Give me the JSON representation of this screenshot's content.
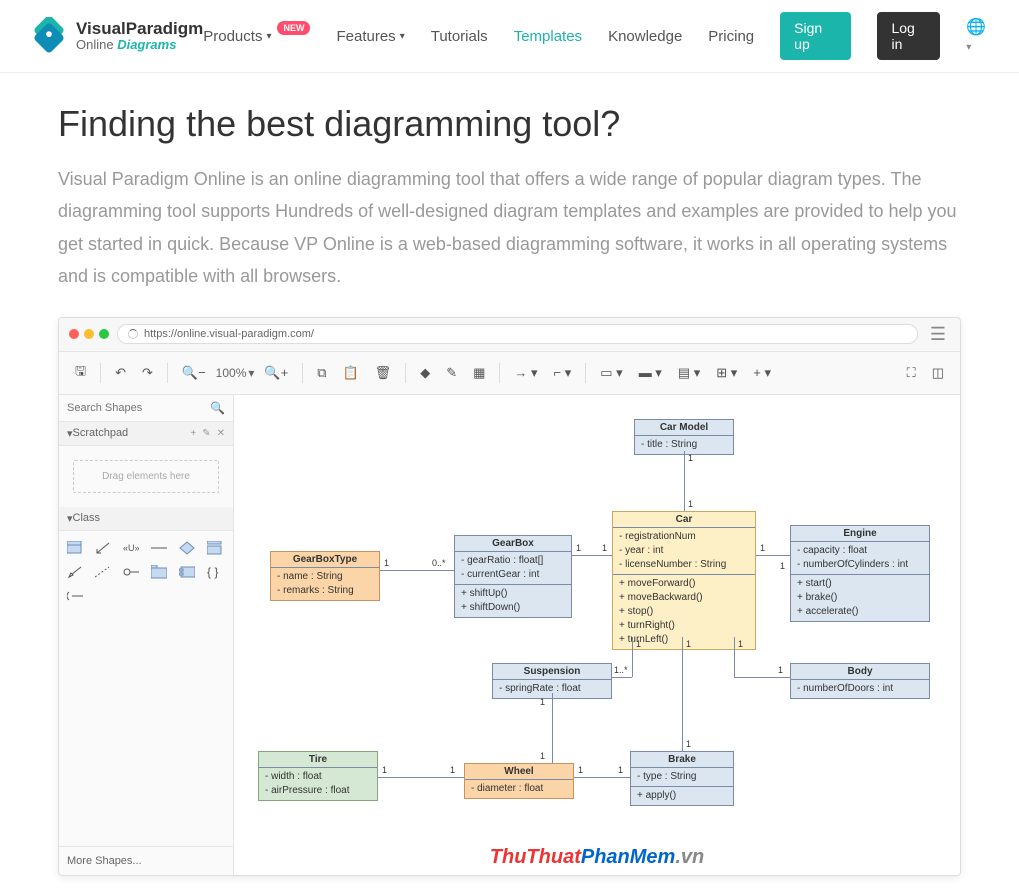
{
  "brand": {
    "name": "VisualParadigm",
    "sub1": "Online",
    "sub2": "Diagrams"
  },
  "nav": {
    "products": "Products",
    "new_badge": "NEW",
    "features": "Features",
    "tutorials": "Tutorials",
    "templates": "Templates",
    "knowledge": "Knowledge",
    "pricing": "Pricing",
    "signup": "Sign up",
    "login": "Log in"
  },
  "page": {
    "title": "Finding the best diagramming tool?",
    "lead": "Visual Paradigm Online is an online diagramming tool that offers a wide range of popular diagram types. The diagramming tool supports Hundreds of well-designed diagram templates and examples are provided to help you get started in quick. Because VP Online is a web-based diagramming software, it works in all operating systems and is compatible with all browsers."
  },
  "browser": {
    "url": "https://online.visual-paradigm.com/"
  },
  "toolbar": {
    "zoom": "100%"
  },
  "sidebar": {
    "search_placeholder": "Search Shapes",
    "scratchpad": "Scratchpad",
    "drop_hint": "Drag elements here",
    "class_panel": "Class",
    "more": "More Shapes..."
  },
  "uml": {
    "carModel": {
      "name": "Car Model",
      "attrs": "- title : String"
    },
    "car": {
      "name": "Car",
      "attrs": "- registrationNum\n- year : int\n- licenseNumber : String",
      "ops": "+ moveForward()\n+ moveBackward()\n+ stop()\n+ turnRight()\n+ turnLeft()"
    },
    "gearBoxType": {
      "name": "GearBoxType",
      "attrs": "- name : String\n- remarks : String"
    },
    "gearBox": {
      "name": "GearBox",
      "attrs": "- gearRatio : float[]\n- currentGear : int",
      "ops": "+ shiftUp()\n+ shiftDown()"
    },
    "engine": {
      "name": "Engine",
      "attrs": "- capacity : float\n- numberOfCylinders : int",
      "ops": "+ start()\n+ brake()\n+ accelerate()"
    },
    "suspension": {
      "name": "Suspension",
      "attrs": "- springRate : float"
    },
    "body": {
      "name": "Body",
      "attrs": "- numberOfDoors : int"
    },
    "tire": {
      "name": "Tire",
      "attrs": "- width : float\n- airPressure : float"
    },
    "wheel": {
      "name": "Wheel",
      "attrs": "- diameter : float"
    },
    "brake": {
      "name": "Brake",
      "attrs": "- type : String",
      "ops": "+ apply()"
    }
  },
  "mults": {
    "one": "1",
    "zeroStar": "0..*",
    "oneStar": "1..*"
  },
  "watermark": {
    "p1": "ThuThuat",
    "p2": "PhanMem",
    "p3": ".vn"
  }
}
